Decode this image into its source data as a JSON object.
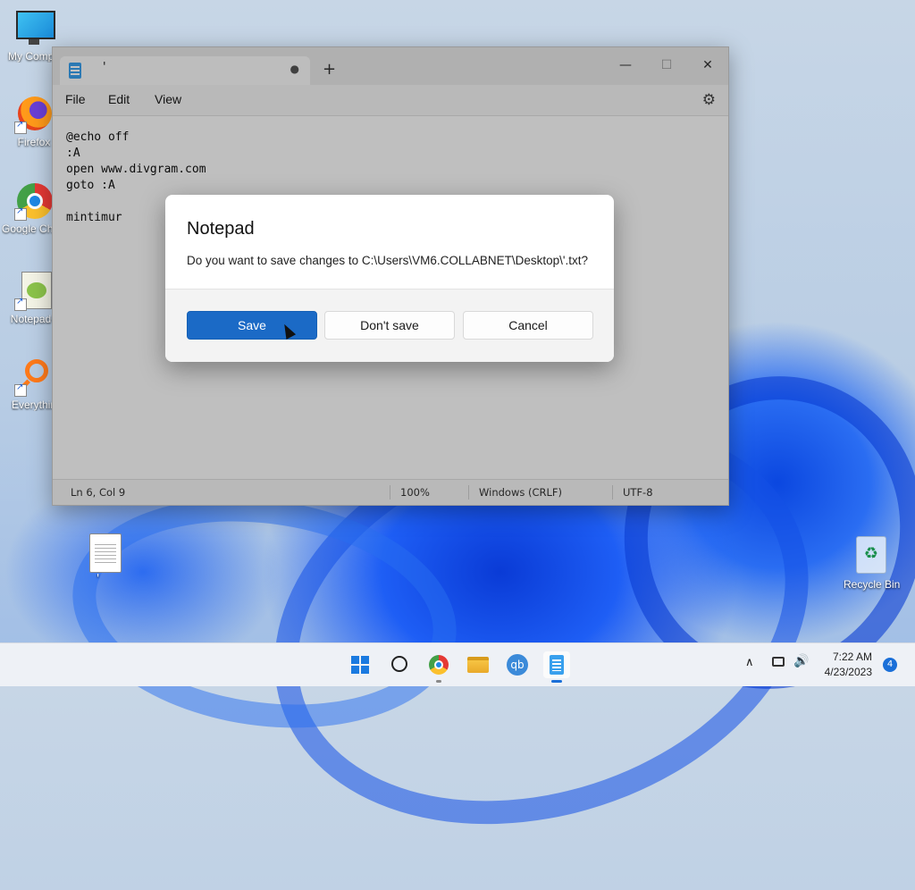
{
  "desktop": {
    "icons": [
      {
        "label": "My Compu",
        "icon": "computer-icon"
      },
      {
        "label": "Firefox",
        "icon": "firefox-icon"
      },
      {
        "label": "Google Chrome",
        "icon": "chrome-icon"
      },
      {
        "label": "Notepad+",
        "icon": "notepadpp-icon"
      },
      {
        "label": "Everythin",
        "icon": "everything-icon"
      }
    ],
    "file_label": "'",
    "recycle_bin_label": "Recycle Bin"
  },
  "notepad": {
    "tab_title": "'",
    "tab_modified_dot": "●",
    "new_tab": "+",
    "window_buttons": {
      "minimize": "—",
      "maximize": "☐",
      "close": "✕"
    },
    "menu": [
      "File",
      "Edit",
      "View"
    ],
    "lines": [
      "@echo off",
      ":A",
      "open www.divgram.com",
      "goto :A",
      "",
      "mintimur"
    ],
    "status": {
      "position": "Ln 6, Col 9",
      "zoom": "100%",
      "line_ending": "Windows (CRLF)",
      "encoding": "UTF-8"
    }
  },
  "dialog": {
    "title": "Notepad",
    "message": "Do you want to save changes to C:\\Users\\VM6.COLLABNET\\Desktop\\'.txt?",
    "buttons": {
      "save": "Save",
      "dont_save": "Don't save",
      "cancel": "Cancel"
    }
  },
  "taskbar": {
    "apps": [
      "start-icon",
      "search-icon",
      "chrome-icon",
      "file-explorer-icon",
      "qbittorrent-icon",
      "notepad-icon"
    ],
    "qb_label": "qb",
    "tray": {
      "chevron": "∧",
      "time": "7:22 AM",
      "date": "4/23/2023",
      "notifications": "4"
    }
  },
  "colors": {
    "accent": "#1b6ac6",
    "taskbar": "#eef1f6"
  }
}
